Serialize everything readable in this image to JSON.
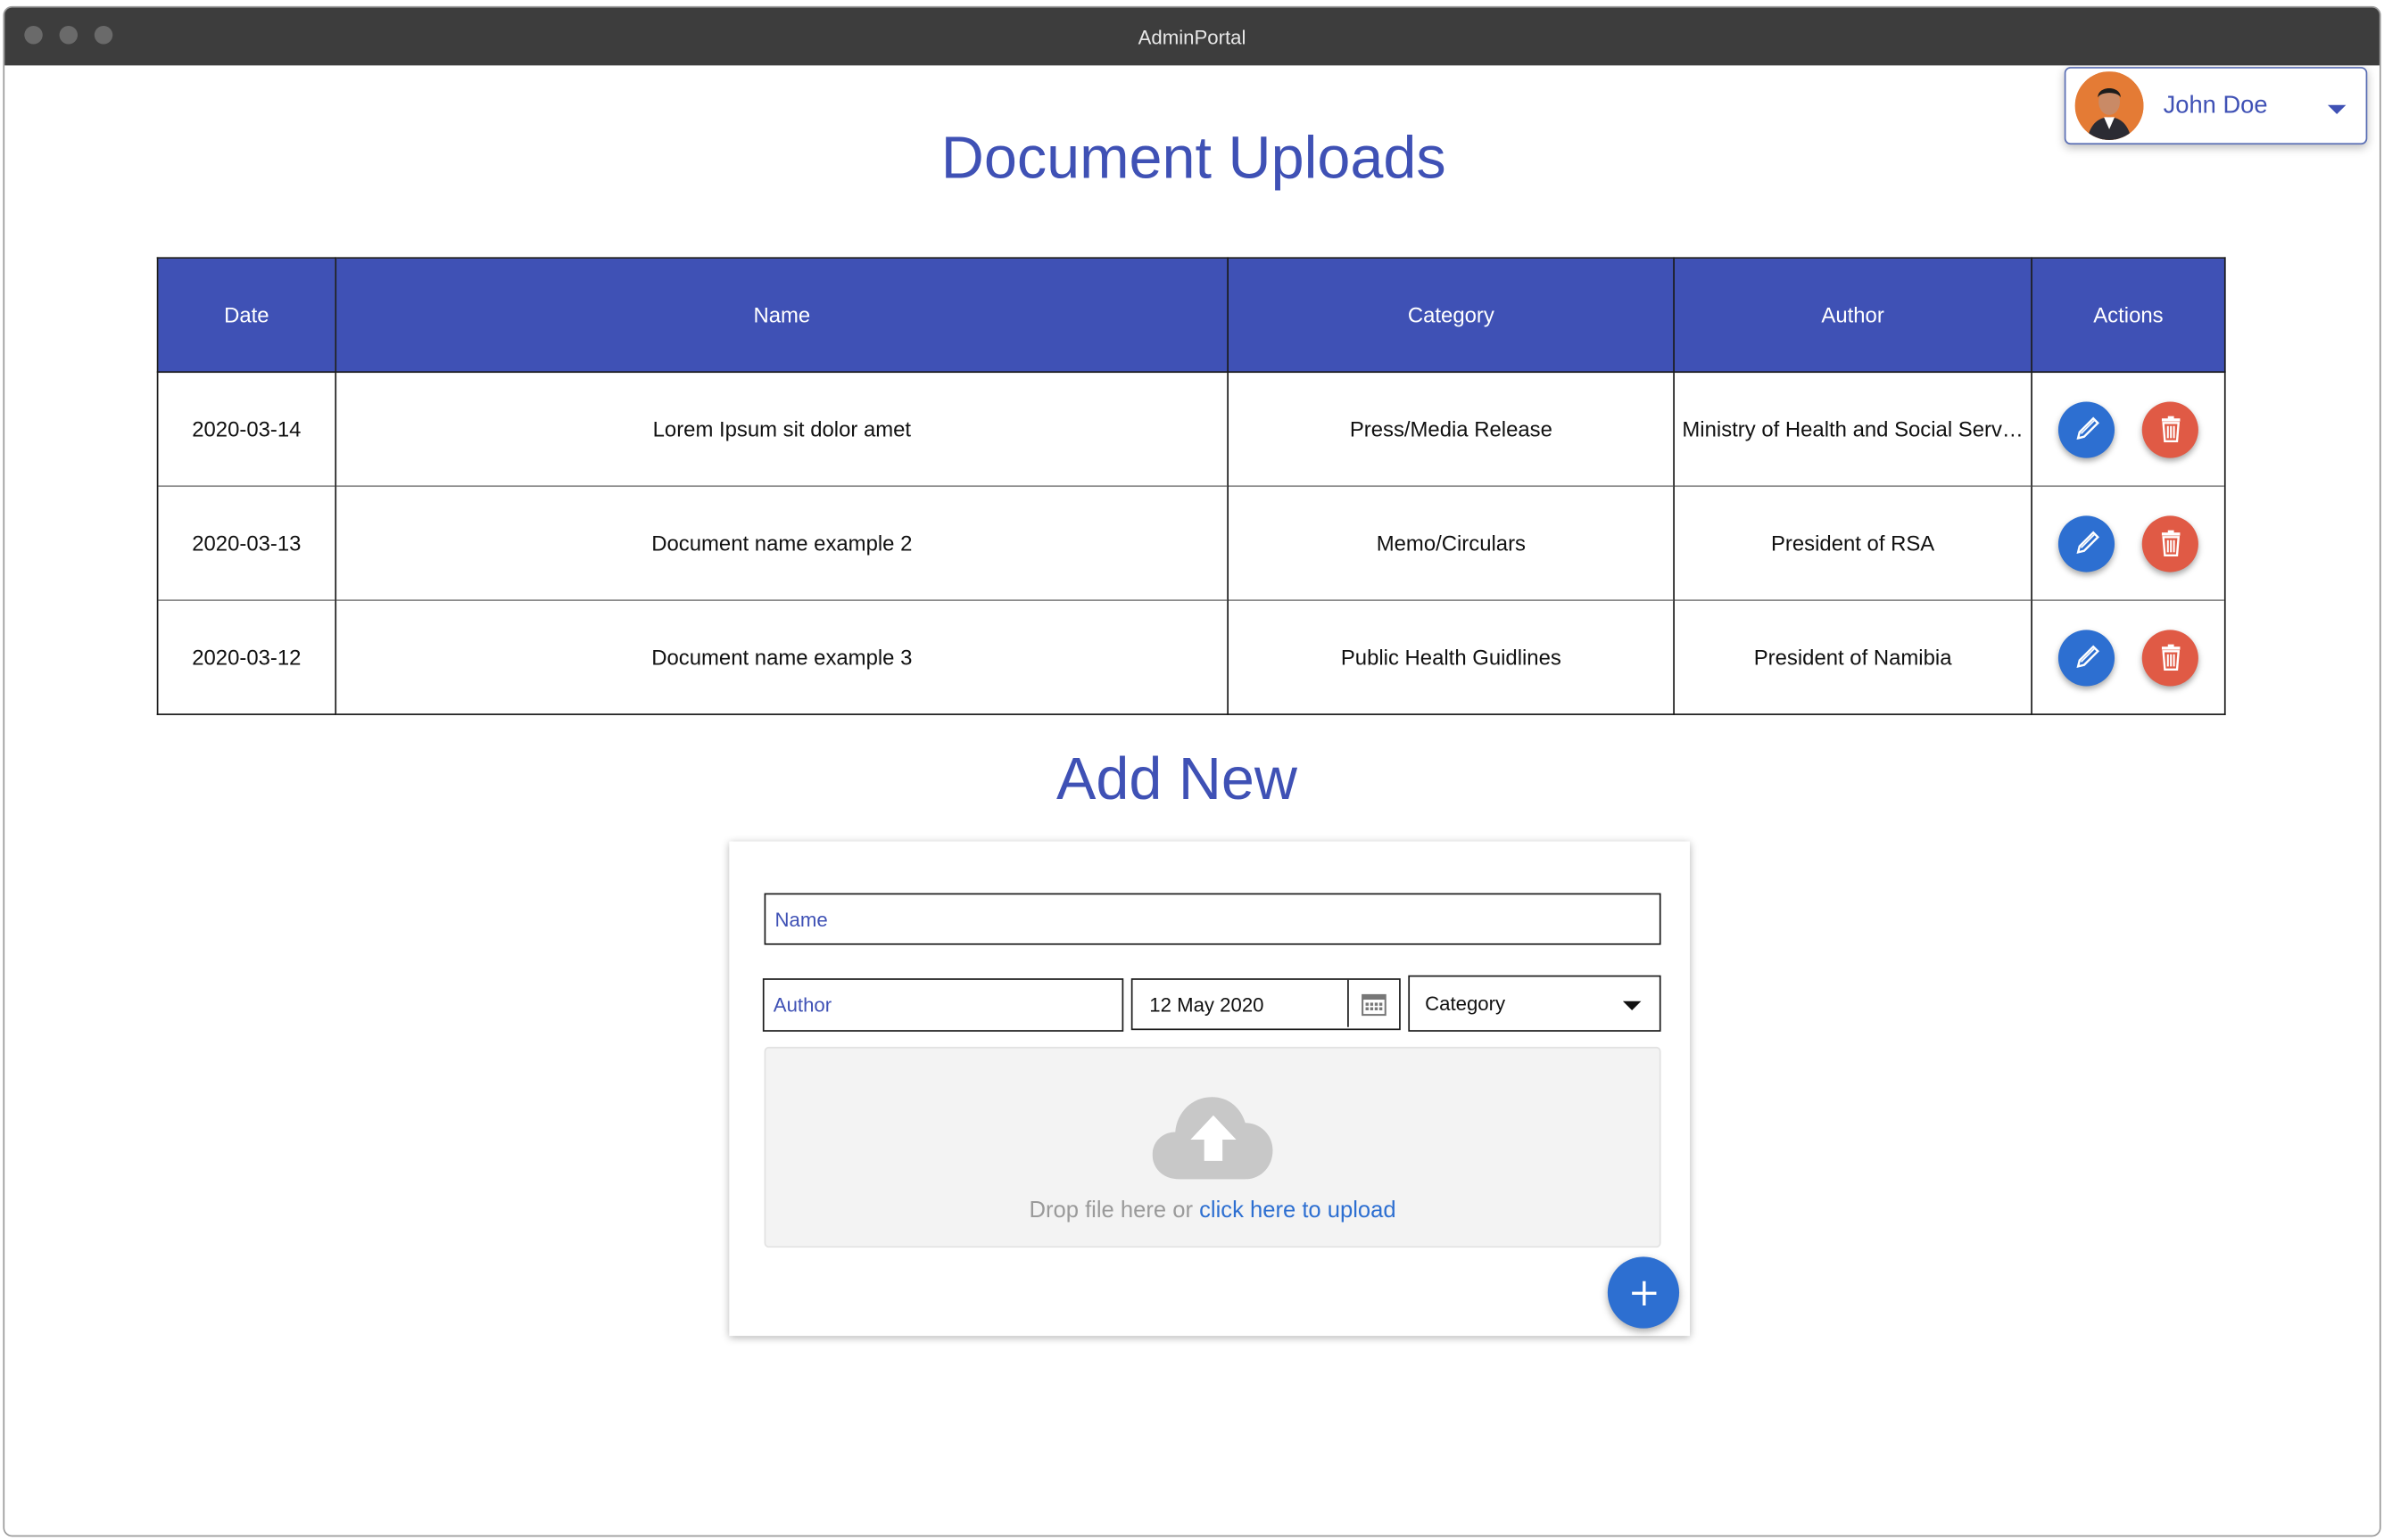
{
  "window": {
    "title": "AdminPortal"
  },
  "user": {
    "name": "John Doe"
  },
  "page": {
    "title": "Document Uploads"
  },
  "table": {
    "columns": [
      "Date",
      "Name",
      "Category",
      "Author",
      "Actions"
    ],
    "rows": [
      {
        "date": "2020-03-14",
        "name": "Lorem Ipsum sit dolor amet",
        "category": "Press/Media Release",
        "author": "Ministry of Health and Social Serv…"
      },
      {
        "date": "2020-03-13",
        "name": "Document name example 2",
        "category": "Memo/Circulars",
        "author": "President of RSA"
      },
      {
        "date": "2020-03-12",
        "name": "Document name example 3",
        "category": "Public Health Guidlines",
        "author": "President of Namibia"
      }
    ]
  },
  "add_new": {
    "title": "Add New",
    "name_placeholder": "Name",
    "author_placeholder": "Author",
    "date_value": "12 May 2020",
    "category_selected": "Category",
    "drop_text": "Drop file here or ",
    "drop_link": "click here to upload"
  },
  "colors": {
    "primary": "#3f51b5",
    "action_blue": "#2d6fd1",
    "delete_red": "#e05a45",
    "titlebar": "#3d3d3d"
  },
  "icons": {
    "edit": "pencil-icon",
    "delete": "trash-icon",
    "upload": "cloud-upload-icon",
    "calendar": "calendar-icon",
    "add": "plus-icon"
  }
}
